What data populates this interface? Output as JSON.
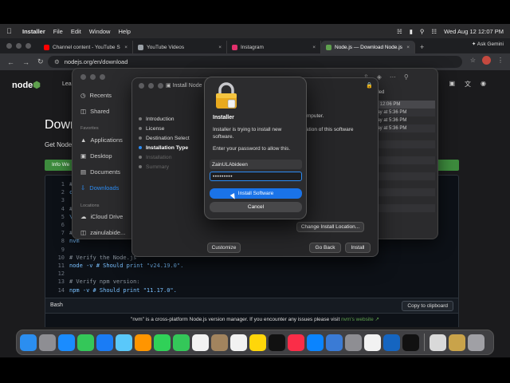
{
  "menubar": {
    "app": "Installer",
    "items": [
      "File",
      "Edit",
      "Window",
      "Help"
    ],
    "datetime": "Wed Aug 12  12:07 PM"
  },
  "browser": {
    "tabs": [
      {
        "label": "Channel content - YouTube S",
        "color": "#ff0000"
      },
      {
        "label": "YouTube Videos",
        "color": "#9aa0a6"
      },
      {
        "label": "Instagram",
        "color": "#e1306c"
      },
      {
        "label": "Node.js — Download Node.js",
        "color": "#5fa04e"
      }
    ],
    "ask": "Ask Gemini",
    "url": "nodejs.org/en/download"
  },
  "site": {
    "logo": "node",
    "nav_partial": "Lea",
    "heading": "Down",
    "subtitle": "Get Node",
    "info_tab": "Info  We",
    "code_lines": [
      {
        "n": "1",
        "t": "# ",
        "c": "cm"
      },
      {
        "n": "2",
        "t": "cu",
        "c": "cd"
      },
      {
        "n": "3",
        "t": "",
        "c": "cd"
      },
      {
        "n": "4",
        "t": "# ",
        "c": "cm"
      },
      {
        "n": "5",
        "t": "\\.",
        "c": "cd"
      },
      {
        "n": "6",
        "t": "",
        "c": "cd"
      },
      {
        "n": "7",
        "t": "# ",
        "c": "cm"
      },
      {
        "n": "8",
        "t": "nvm",
        "c": "cd"
      },
      {
        "n": "9",
        "t": "",
        "c": "cd"
      },
      {
        "n": "10",
        "t": "# Verify the Node.js",
        "c": "cm"
      },
      {
        "n": "11",
        "t": "node -v # Should print \"v24.19.0\".",
        "c": "cd"
      },
      {
        "n": "12",
        "t": "",
        "c": "cd"
      },
      {
        "n": "13",
        "t": "# Verify npm version:",
        "c": "cm"
      },
      {
        "n": "14",
        "t": "npm -v # Should print \"11.17.0\".",
        "c": "cd"
      }
    ],
    "shell": "Bash",
    "copy": "Copy to clipboard",
    "footnote_pre": "\"nvm\" is a cross-platform Node.js version manager. If you encounter any issues please visit ",
    "footnote_link": "nvm's website ↗"
  },
  "finder": {
    "items": [
      {
        "label": "Recents"
      },
      {
        "label": "Shared"
      },
      {
        "label": "Applications"
      },
      {
        "label": "Desktop"
      },
      {
        "label": "Documents"
      },
      {
        "label": "Downloads"
      },
      {
        "label": "iCloud Drive"
      },
      {
        "label": "zainulabide..."
      }
    ],
    "section_favorites": "Favorites",
    "section_locations": "Locations",
    "title_partial": "Downloa",
    "col_header": "dded",
    "dates": [
      "at 12:06 PM",
      "day at 5:36 PM",
      "day at 5:36 PM",
      "day at 5:36 PM"
    ]
  },
  "installer": {
    "title": "Install Node",
    "steps": [
      {
        "label": "Introduction",
        "state": "done"
      },
      {
        "label": "License",
        "state": "done"
      },
      {
        "label": "Destination Select",
        "state": "done"
      },
      {
        "label": "Installation Type",
        "state": "active"
      },
      {
        "label": "Installation",
        "state": "dim"
      },
      {
        "label": "Summary",
        "state": "dim"
      }
    ],
    "body1": "r computer.",
    "body2": "llation of this software",
    "change_location": "Change Install Location...",
    "customize": "Customize",
    "go_back": "Go Back",
    "install": "Install"
  },
  "dialog": {
    "title": "Installer",
    "message": "Installer is trying to install new software.",
    "prompt": "Enter your password to allow this.",
    "username": "ZainULAbideen",
    "password": "•••••••••",
    "primary": "Install Software",
    "secondary": "Cancel"
  },
  "dock": {
    "apps": [
      {
        "name": "finder",
        "color": "#2b8ef0"
      },
      {
        "name": "launchpad",
        "color": "#8e8e93"
      },
      {
        "name": "safari",
        "color": "#1a8cff"
      },
      {
        "name": "messages",
        "color": "#34c759"
      },
      {
        "name": "mail",
        "color": "#1a7cf5"
      },
      {
        "name": "maps",
        "color": "#5ac8fa"
      },
      {
        "name": "photos",
        "color": "#ff9500"
      },
      {
        "name": "facetime",
        "color": "#30d158"
      },
      {
        "name": "phone",
        "color": "#34c759"
      },
      {
        "name": "calendar",
        "color": "#f2f2f2"
      },
      {
        "name": "contacts",
        "color": "#a2845e"
      },
      {
        "name": "reminders",
        "color": "#f2f2f2"
      },
      {
        "name": "notes",
        "color": "#ffd60a"
      },
      {
        "name": "tv",
        "color": "#111111"
      },
      {
        "name": "music",
        "color": "#fa2d48"
      },
      {
        "name": "app-store",
        "color": "#0a84ff"
      },
      {
        "name": "preview",
        "color": "#3a7bd5"
      },
      {
        "name": "system-settings",
        "color": "#8e8e93"
      },
      {
        "name": "chrome",
        "color": "#f2f2f2"
      },
      {
        "name": "vpn",
        "color": "#1565c0"
      },
      {
        "name": "capcut",
        "color": "#111111"
      },
      {
        "name": "installer-app",
        "color": "#d9d9d9"
      },
      {
        "name": "package",
        "color": "#c9a34a"
      },
      {
        "name": "trash",
        "color": "#a0a0a5"
      }
    ]
  }
}
